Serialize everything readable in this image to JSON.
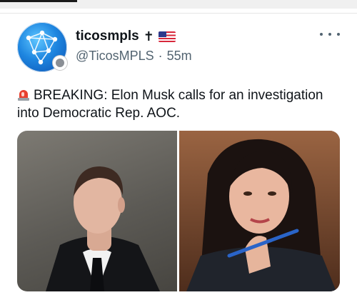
{
  "post": {
    "display_name": "ticosmpls",
    "name_suffix_cross": "✝",
    "handle": "@TicosMPLS",
    "separator": "·",
    "time_ago": "55m",
    "text": "BREAKING: Elon Musk calls for an investigation into Democratic Rep. AOC."
  },
  "icons": {
    "menu": "more-horizontal-icon",
    "alert": "siren-icon",
    "flag": "us-flag-icon"
  },
  "colors": {
    "name": "#0f1419",
    "secondary": "#536471",
    "avatar_blue": "#1e86e0"
  }
}
